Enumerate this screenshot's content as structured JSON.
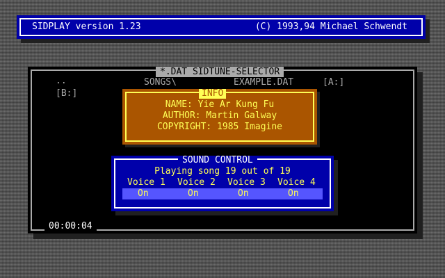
{
  "header": {
    "app_title": "SIDPLAY version 1.23",
    "copyright": "(C) 1993,94 Michael Schwendt"
  },
  "selector": {
    "title": "*.DAT SIDTUNE-SELECTOR",
    "parent_dir": "..",
    "current_dir": "SONGS\\",
    "file": "EXAMPLE.DAT",
    "drive_a": "[A:]",
    "drive_b": "[B:]",
    "timer": "00:00:04"
  },
  "info": {
    "title": "INFO",
    "name": "NAME: Yie Ar Kung Fu",
    "author": "AUTHOR: Martin Galway",
    "copyright": "COPYRIGHT: 1985 Imagine"
  },
  "sound_control": {
    "title": "SOUND CONTROL",
    "status": "Playing song 19 out of 19",
    "voices": [
      {
        "label": "Voice 1",
        "state": "On"
      },
      {
        "label": "Voice 2",
        "state": "On"
      },
      {
        "label": "Voice 3",
        "state": "On"
      },
      {
        "label": "Voice 4",
        "state": "On"
      }
    ]
  },
  "colors": {
    "dos_blue": "#0000aa",
    "info_brown": "#aa5500",
    "highlight_yellow": "#ffff55",
    "selection_blue": "#5555ff"
  }
}
